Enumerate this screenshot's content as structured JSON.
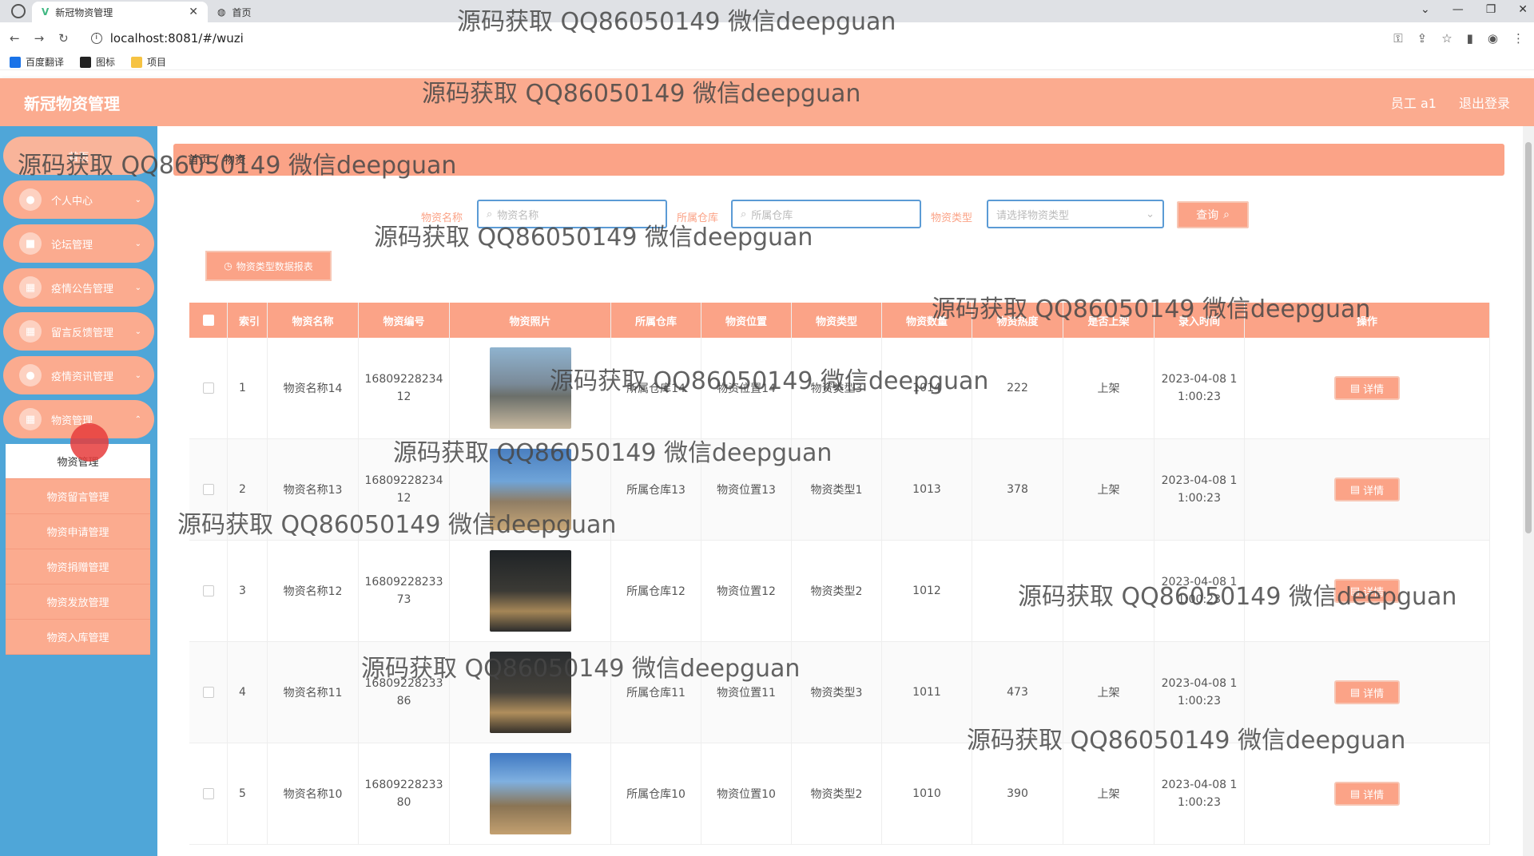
{
  "browser": {
    "tabs": [
      {
        "label": "新冠物资管理",
        "active": true
      },
      {
        "label": "首页",
        "active": false
      }
    ],
    "url": "localhost:8081/#/wuzi",
    "bookmarks": [
      "百度翻译",
      "图标",
      "项目"
    ]
  },
  "header": {
    "title": "新冠物资管理",
    "user": "员工 a1",
    "logout": "退出登录"
  },
  "sidebar": {
    "home": "首页",
    "items": [
      {
        "label": "个人中心"
      },
      {
        "label": "论坛管理"
      },
      {
        "label": "疫情公告管理"
      },
      {
        "label": "留言反馈管理"
      },
      {
        "label": "疫情资讯管理"
      },
      {
        "label": "物资管理"
      }
    ],
    "submenu": [
      "物资管理",
      "物资留言管理",
      "物资申请管理",
      "物资捐赠管理",
      "物资发放管理",
      "物资入库管理"
    ]
  },
  "breadcrumb": {
    "home": "首页",
    "sep": "/",
    "current": "物资"
  },
  "search": {
    "name_label": "物资名称",
    "name_placeholder": "物资名称",
    "wh_label": "所属仓库",
    "wh_placeholder": "所属仓库",
    "type_label": "物资类型",
    "type_placeholder": "请选择物资类型",
    "query_btn": "查询"
  },
  "chart_btn": "物资类型数据报表",
  "table": {
    "headers": [
      "索引",
      "物资名称",
      "物资编号",
      "物资照片",
      "所属仓库",
      "物资位置",
      "物资类型",
      "物资数量",
      "物资热度",
      "是否上架",
      "录入时间",
      "操作"
    ],
    "detail_label": "详情",
    "rows": [
      {
        "idx": "1",
        "name": "物资名称14",
        "code": "16809228234\n12",
        "wh": "所属仓库14",
        "loc": "物资位置14",
        "type": "物资类型3",
        "qty": "1014",
        "heat": "222",
        "shelf": "上架",
        "time": "2023-04-08 1\n1:00:23"
      },
      {
        "idx": "2",
        "name": "物资名称13",
        "code": "16809228234\n12",
        "wh": "所属仓库13",
        "loc": "物资位置13",
        "type": "物资类型1",
        "qty": "1013",
        "heat": "378",
        "shelf": "上架",
        "time": "2023-04-08 1\n1:00:23"
      },
      {
        "idx": "3",
        "name": "物资名称12",
        "code": "16809228233\n73",
        "wh": "所属仓库12",
        "loc": "物资位置12",
        "type": "物资类型2",
        "qty": "1012",
        "heat": "",
        "shelf": "",
        "time": "2023-04-08 1\n1:00:23"
      },
      {
        "idx": "4",
        "name": "物资名称11",
        "code": "16809228233\n86",
        "wh": "所属仓库11",
        "loc": "物资位置11",
        "type": "物资类型3",
        "qty": "1011",
        "heat": "473",
        "shelf": "上架",
        "time": "2023-04-08 1\n1:00:23"
      },
      {
        "idx": "5",
        "name": "物资名称10",
        "code": "16809228233\n80",
        "wh": "所属仓库10",
        "loc": "物资位置10",
        "type": "物资类型2",
        "qty": "1010",
        "heat": "390",
        "shelf": "上架",
        "time": "2023-04-08 1\n1:00:23"
      }
    ]
  },
  "watermark": "源码获取 QQ86050149 微信deepguan",
  "colors": {
    "accent": "#fba387",
    "sidebar": "#4fa6d8",
    "input_border": "#5b9bd5"
  }
}
